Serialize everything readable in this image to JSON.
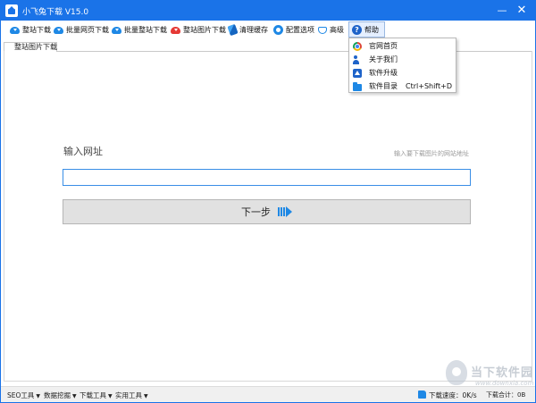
{
  "window": {
    "title": "小飞兔下载 V15.0",
    "minimize": "—",
    "close": "✕"
  },
  "toolbar": {
    "items": [
      {
        "label": "整站下载",
        "icon": "cloud-download-icon"
      },
      {
        "label": "批量网页下载",
        "icon": "cloud-download-icon"
      },
      {
        "label": "批量整站下载",
        "icon": "cloud-download-icon"
      },
      {
        "label": "整站图片下载",
        "icon": "cloud-download-red-icon"
      },
      {
        "label": "清理缓存",
        "icon": "broom-icon"
      },
      {
        "label": "配置选项",
        "icon": "gear-icon"
      },
      {
        "label": "高级",
        "icon": "diamond-icon"
      },
      {
        "label": "帮助",
        "icon": "help-icon"
      }
    ]
  },
  "help_menu": {
    "items": [
      {
        "label": "官网首页",
        "icon": "chrome-icon",
        "shortcut": ""
      },
      {
        "label": "关于我们",
        "icon": "users-icon",
        "shortcut": ""
      },
      {
        "label": "软件升级",
        "icon": "upgrade-icon",
        "shortcut": ""
      },
      {
        "label": "软件目录",
        "icon": "folder-icon",
        "shortcut": "Ctrl+Shift+D"
      }
    ]
  },
  "tab": {
    "label": "整站图片下载"
  },
  "form": {
    "url_label": "输入网址",
    "url_hint": "输入要下载图片的网站地址",
    "url_value": "",
    "next_label": "下一步"
  },
  "statusbar": {
    "menus": [
      "SEO工具",
      "数据挖掘",
      "下载工具",
      "实用工具"
    ],
    "speed": "下载速度：0K/s",
    "total": "下载合计：0B"
  },
  "watermark": {
    "title": "当下软件园",
    "url": "www.downxia.com"
  },
  "colors": {
    "accent": "#1a73e8",
    "input_border": "#3a8ee6",
    "button_bg": "#e1e1e1"
  }
}
